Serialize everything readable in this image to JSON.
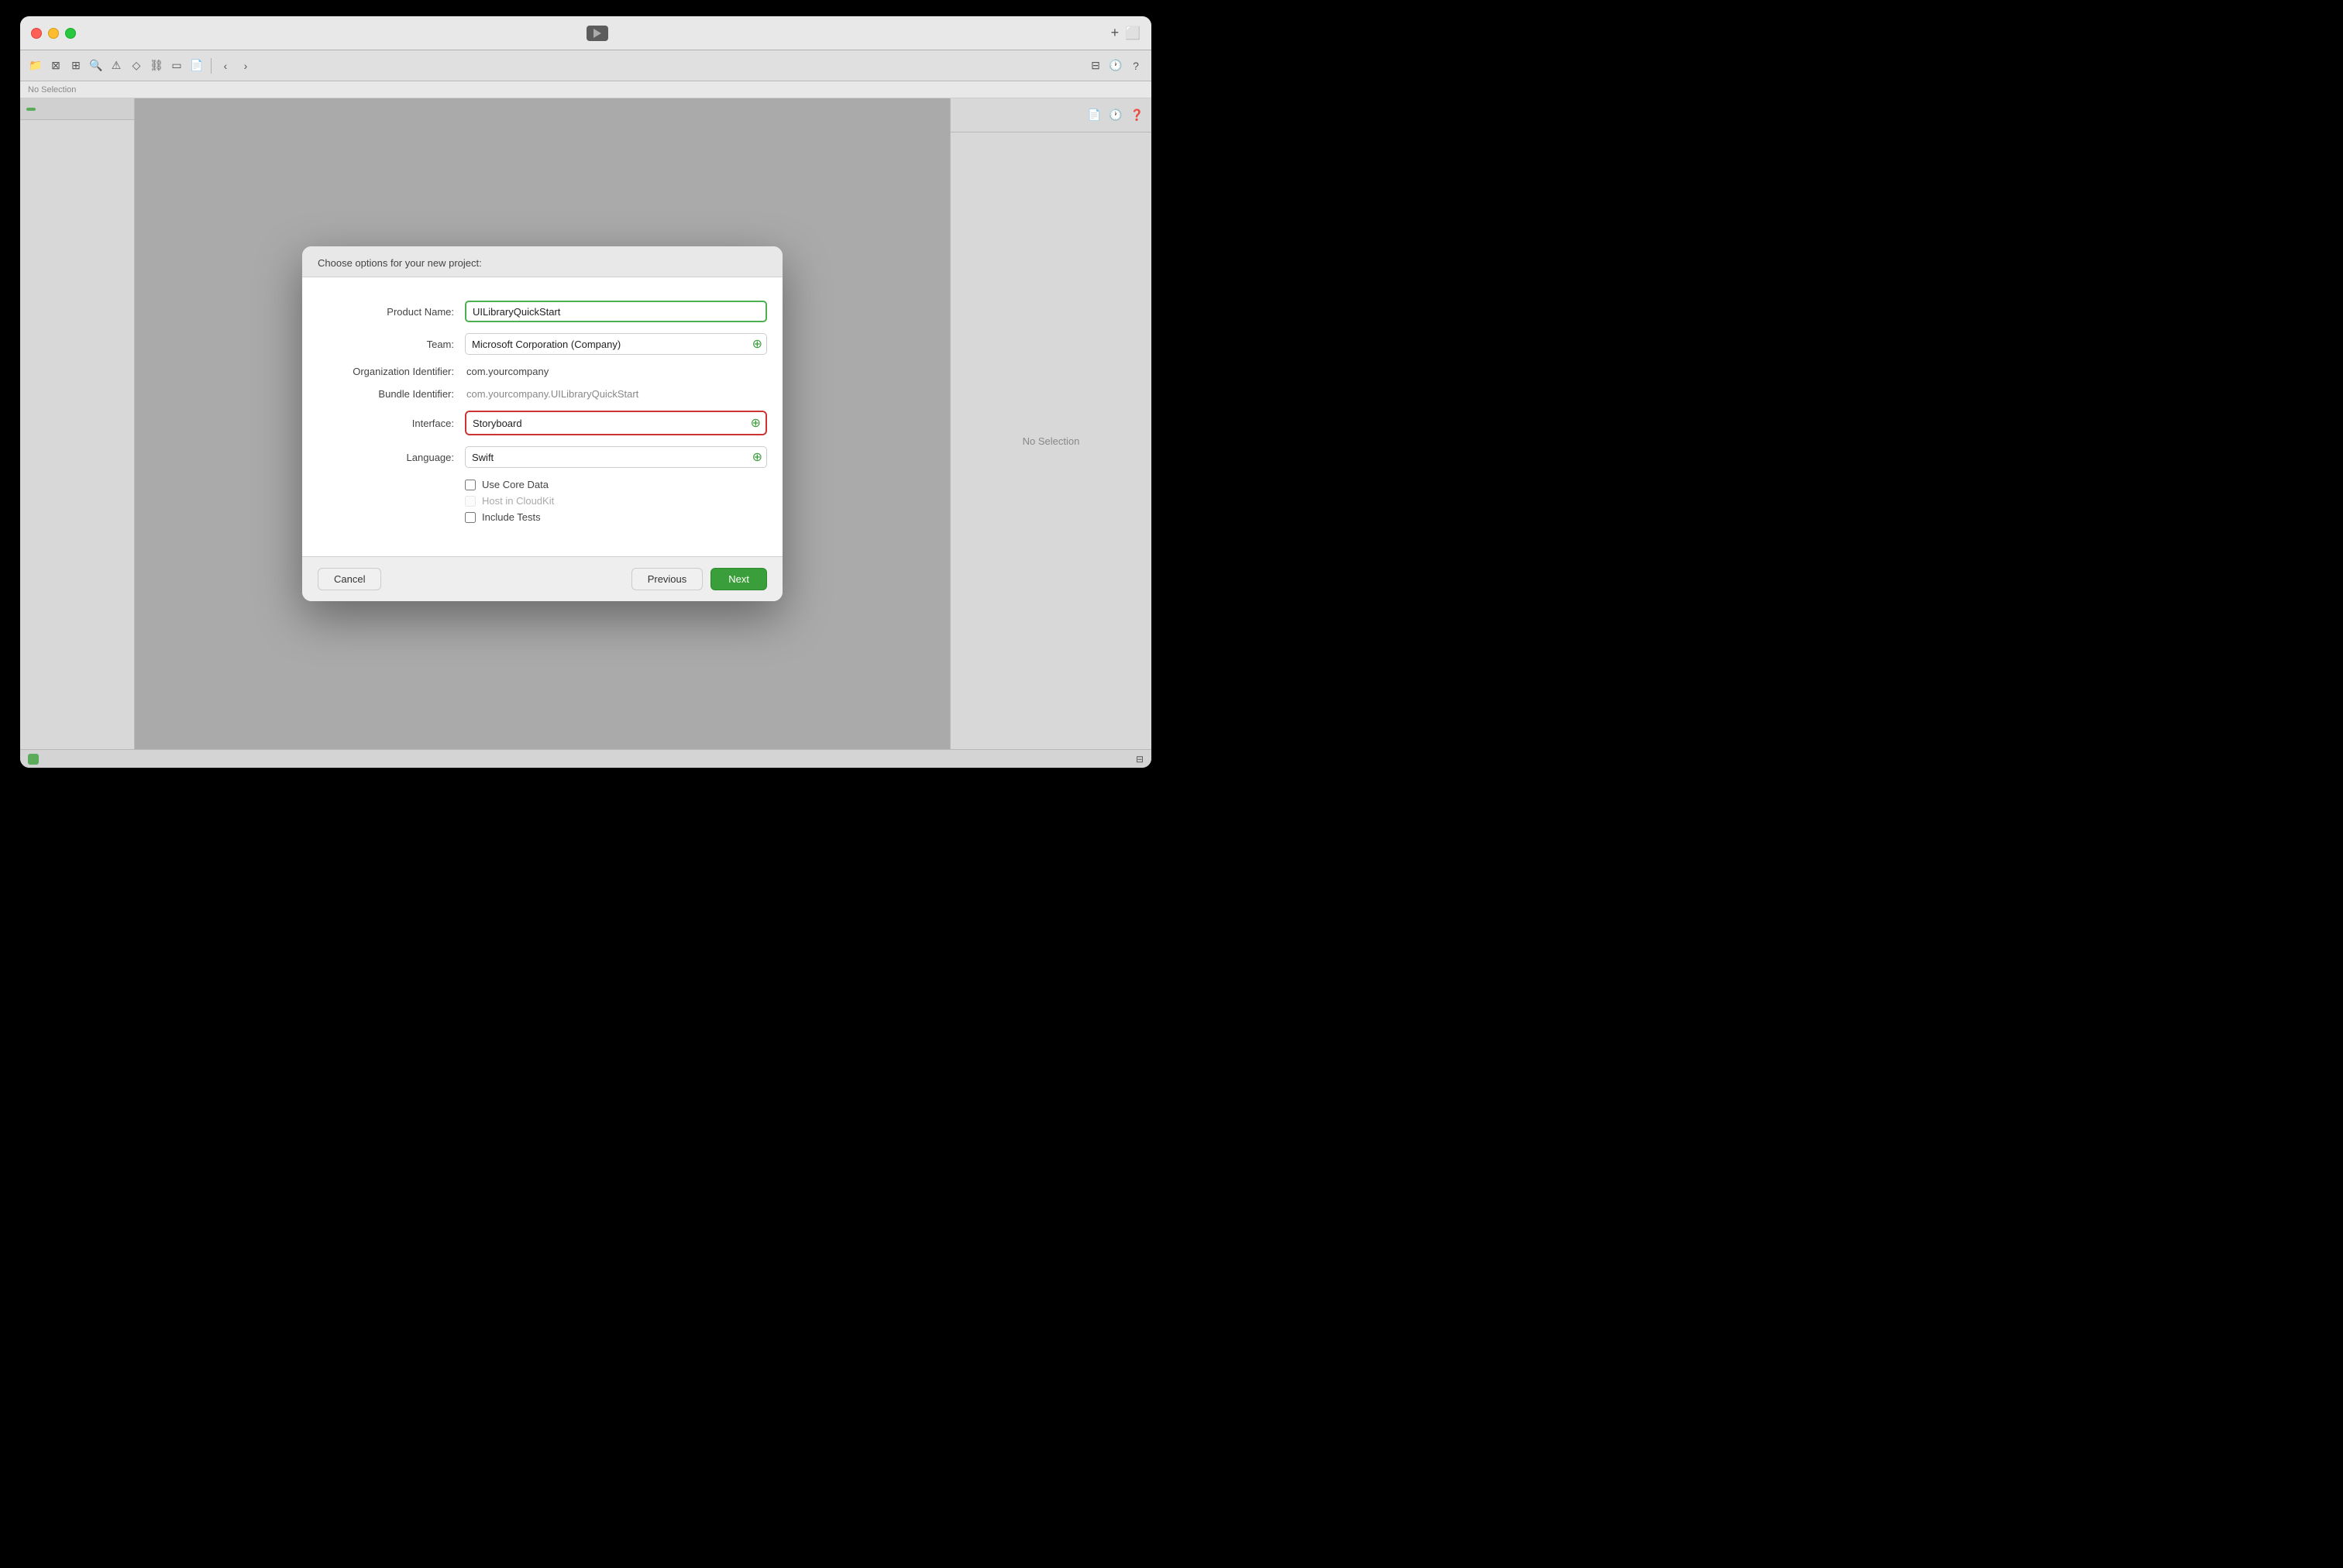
{
  "window": {
    "no_selection_top": "No Selection",
    "no_selection_right": "No Selection"
  },
  "toolbar": {
    "icons": [
      "folder",
      "x-square",
      "grid",
      "magnifier",
      "warning",
      "diamond",
      "link",
      "square",
      "file",
      "arrow-back",
      "arrow-forward",
      "plus"
    ]
  },
  "modal": {
    "title": "Choose options for your new project:",
    "fields": {
      "product_name_label": "Product Name:",
      "product_name_value": "UILibraryQuickStart",
      "team_label": "Team:",
      "team_value": "Microsoft Corporation (Company)",
      "org_identifier_label": "Organization Identifier:",
      "org_identifier_value": "com.yourcompany",
      "bundle_identifier_label": "Bundle Identifier:",
      "bundle_identifier_value": "com.yourcompany.UILibraryQuickStart",
      "interface_label": "Interface:",
      "interface_value": "Storyboard",
      "language_label": "Language:",
      "language_value": "Swift",
      "use_core_data_label": "Use Core Data",
      "host_in_cloudkit_label": "Host in CloudKit",
      "include_tests_label": "Include Tests"
    },
    "buttons": {
      "cancel": "Cancel",
      "previous": "Previous",
      "next": "Next"
    }
  }
}
